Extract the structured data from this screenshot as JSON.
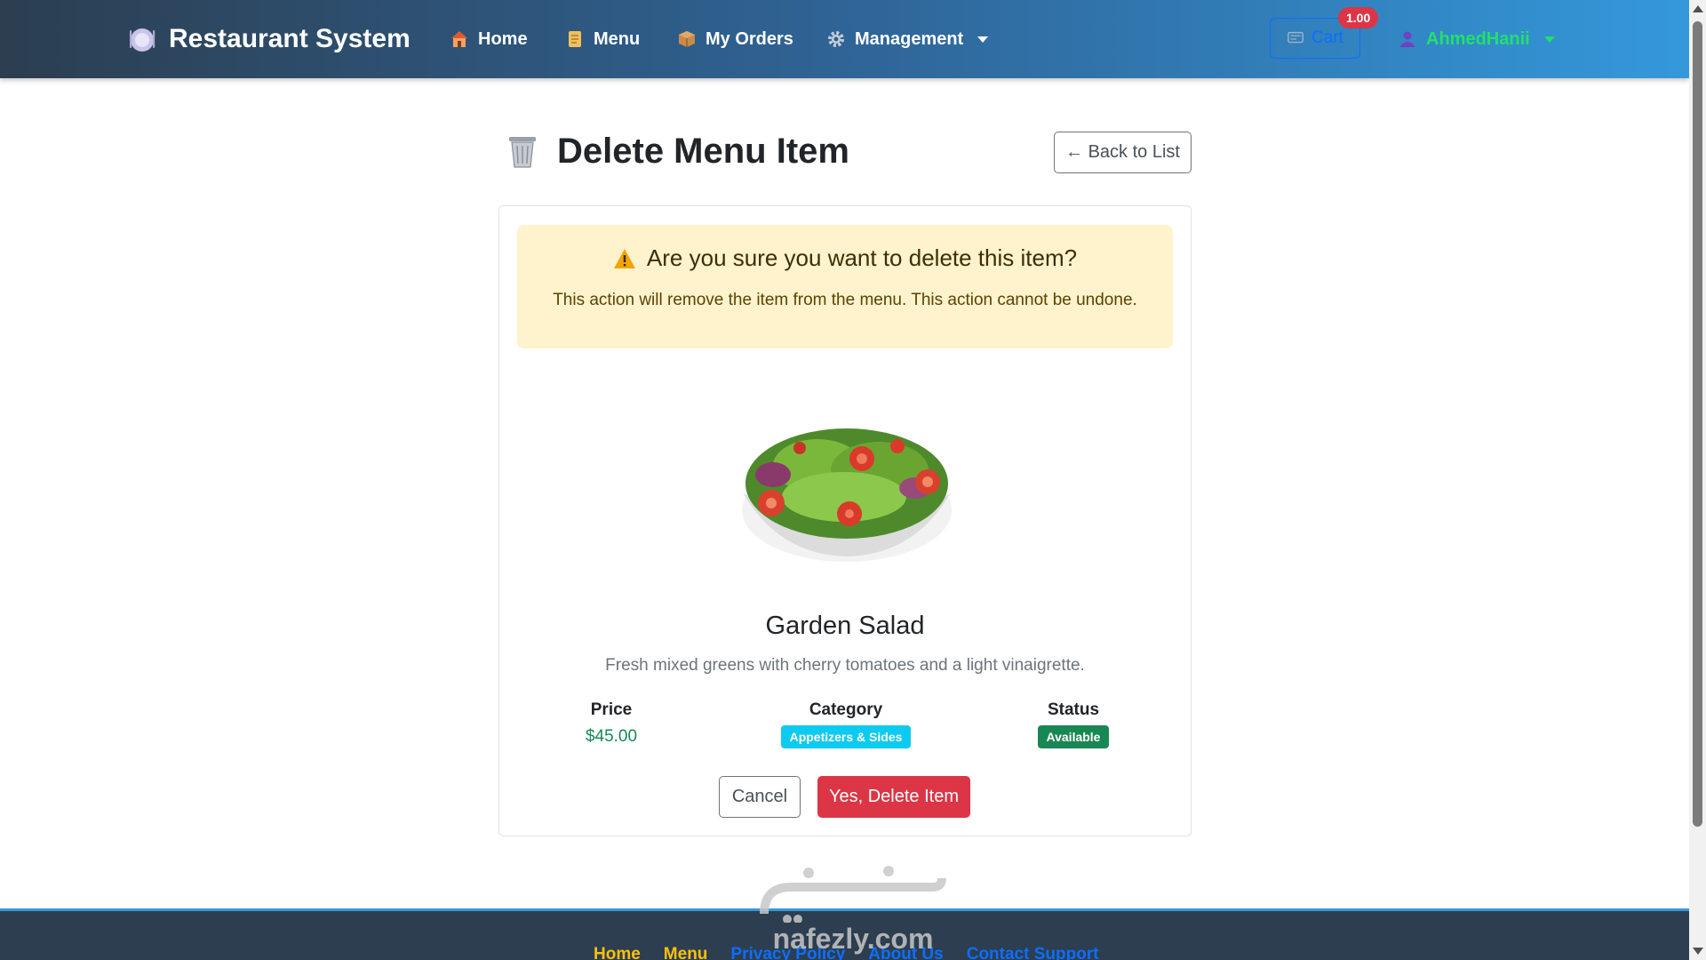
{
  "navbar": {
    "brand": "Restaurant System",
    "links": [
      {
        "label": "Home",
        "icon": "house-icon"
      },
      {
        "label": "Menu",
        "icon": "scroll-icon"
      },
      {
        "label": "My Orders",
        "icon": "package-icon"
      },
      {
        "label": "Management",
        "icon": "gear-icon"
      }
    ],
    "cart": {
      "label": "Cart",
      "badge": "1.00"
    },
    "user": {
      "name": "AhmedHanii",
      "icon": "user-icon"
    }
  },
  "page": {
    "title": "Delete Menu Item",
    "back_label": "← Back to List"
  },
  "alert": {
    "title": "Are you sure you want to delete this item?",
    "text": "This action will remove the item from the menu. This action cannot be undone."
  },
  "item": {
    "name": "Garden Salad",
    "description": "Fresh mixed greens with cherry tomatoes and a light vinaigrette.",
    "price_label": "Price",
    "price": "$45.00",
    "category_label": "Category",
    "category": "Appetizers & Sides",
    "status_label": "Status",
    "status": "Available"
  },
  "actions": {
    "cancel": "Cancel",
    "delete": "Yes, Delete Item"
  },
  "footer": {
    "links": [
      "Home",
      "Menu",
      "Privacy Policy",
      "About Us",
      "Contact Support"
    ]
  },
  "watermark": {
    "text": "nafezly.com"
  },
  "colors": {
    "danger": "#dc3545",
    "info": "#0dcaf0",
    "success": "#198754",
    "warning_bg": "#fff3cd",
    "user": "#22e06b"
  }
}
